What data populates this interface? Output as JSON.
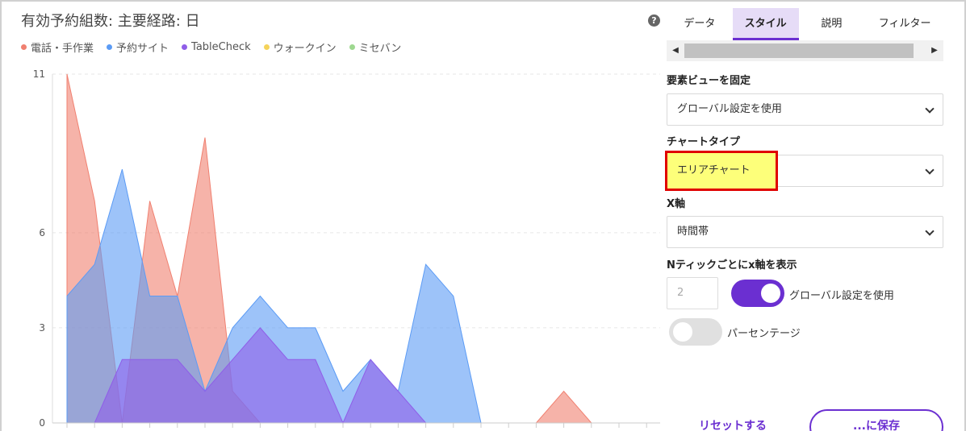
{
  "chart_title": "有効予約組数: 主要経路: 日",
  "help_glyph": "?",
  "legend": [
    {
      "label": "電話・手作業",
      "color": "#f08070"
    },
    {
      "label": "予約サイト",
      "color": "#5b9bf5"
    },
    {
      "label": "TableCheck",
      "color": "#8f5ee8"
    },
    {
      "label": "ウォークイン",
      "color": "#f5d35a"
    },
    {
      "label": "ミセバン",
      "color": "#9ed890"
    }
  ],
  "chart_data": {
    "type": "area",
    "title": "有効予約組数: 主要経路: 日",
    "xlabel": "",
    "ylabel": "",
    "y_ticks": [
      0,
      3,
      6,
      11
    ],
    "ylim": [
      0,
      11
    ],
    "grid": true,
    "legend_position": "top-left",
    "x_count": 22,
    "series": [
      {
        "name": "電話・手作業",
        "color": "#f08070",
        "values": [
          11,
          7,
          0,
          7,
          4,
          9,
          1,
          0,
          0,
          0,
          0,
          0,
          0,
          0,
          0,
          0,
          0,
          0,
          1,
          0,
          0,
          0
        ]
      },
      {
        "name": "予約サイト",
        "color": "#5b9bf5",
        "values": [
          4,
          5,
          8,
          4,
          4,
          1,
          3,
          4,
          3,
          3,
          1,
          2,
          1,
          5,
          4,
          0,
          0,
          0,
          0,
          0,
          0,
          0
        ]
      },
      {
        "name": "TableCheck",
        "color": "#8f5ee8",
        "values": [
          0,
          0,
          2,
          2,
          2,
          1,
          2,
          3,
          2,
          2,
          0,
          2,
          1,
          0,
          0,
          0,
          0,
          0,
          0,
          0,
          0,
          0
        ]
      },
      {
        "name": "ウォークイン",
        "color": "#f5d35a",
        "values": [
          0,
          0,
          0,
          0,
          0,
          0,
          0,
          0,
          0,
          0,
          0,
          0,
          0,
          0,
          0,
          0,
          0,
          0,
          0,
          0,
          0,
          0
        ]
      },
      {
        "name": "ミセバン",
        "color": "#9ed890",
        "values": [
          0,
          0,
          0,
          0,
          0,
          0,
          0,
          0,
          0,
          0,
          0,
          0,
          0,
          0,
          0,
          0,
          0,
          0,
          0,
          0,
          0,
          0
        ]
      }
    ]
  },
  "panel": {
    "tabs": [
      {
        "label": "データ",
        "active": false
      },
      {
        "label": "スタイル",
        "active": true
      },
      {
        "label": "説明",
        "active": false
      },
      {
        "label": "フィルター",
        "active": false
      }
    ],
    "pin_view_label": "要素ビューを固定",
    "pin_view_value": "グローバル設定を使用",
    "chart_type_label": "チャートタイプ",
    "chart_type_value": "エリアチャート",
    "x_axis_label": "X軸",
    "x_axis_value": "時間帯",
    "n_tick_label": "Nティックごとにx軸を表示",
    "n_tick_value": "2",
    "global_toggle_label": "グローバル設定を使用",
    "global_toggle_on": true,
    "percent_toggle_label": "パーセンテージ",
    "percent_toggle_on": false,
    "reset_label": "リセットする",
    "save_label": "...に保存",
    "accent_color": "#6b2fd1"
  }
}
